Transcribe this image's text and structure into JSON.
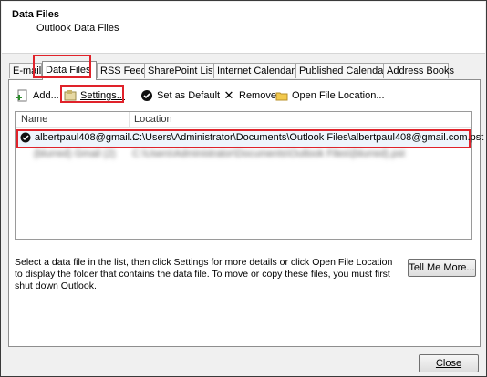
{
  "header": {
    "title": "Data Files",
    "subtitle": "Outlook Data Files"
  },
  "tabs": [
    {
      "label": "E-mail"
    },
    {
      "label": "Data Files",
      "active": true
    },
    {
      "label": "RSS Feeds"
    },
    {
      "label": "SharePoint Lists"
    },
    {
      "label": "Internet Calendars"
    },
    {
      "label": "Published Calendars"
    },
    {
      "label": "Address Books"
    }
  ],
  "toolbar": {
    "add": "Add...",
    "settings": "Settings...",
    "set_default": "Set as Default",
    "remove": "Remove",
    "open_location": "Open File Location..."
  },
  "list": {
    "columns": [
      "Name",
      "Location"
    ],
    "rows": [
      {
        "name": "albertpaul408@gmail...",
        "location": "C:\\Users\\Administrator\\Documents\\Outlook Files\\albertpaul408@gmail.com.pst",
        "default": true
      },
      {
        "name": "(blurred) Gmail (2)",
        "location": "C:\\Users\\Administrator\\Documents\\Outlook Files\\(blurred).pst",
        "default": false
      }
    ]
  },
  "description": "Select a data file in the list, then click Settings for more details or click Open File Location to display the folder that contains the data file. To move or copy these files, you must first shut down Outlook.",
  "buttons": {
    "tell_me_more": "Tell Me More...",
    "close": "Close"
  },
  "colors": {
    "highlight": "#e0222a",
    "selected_row": "#eef5fc"
  }
}
